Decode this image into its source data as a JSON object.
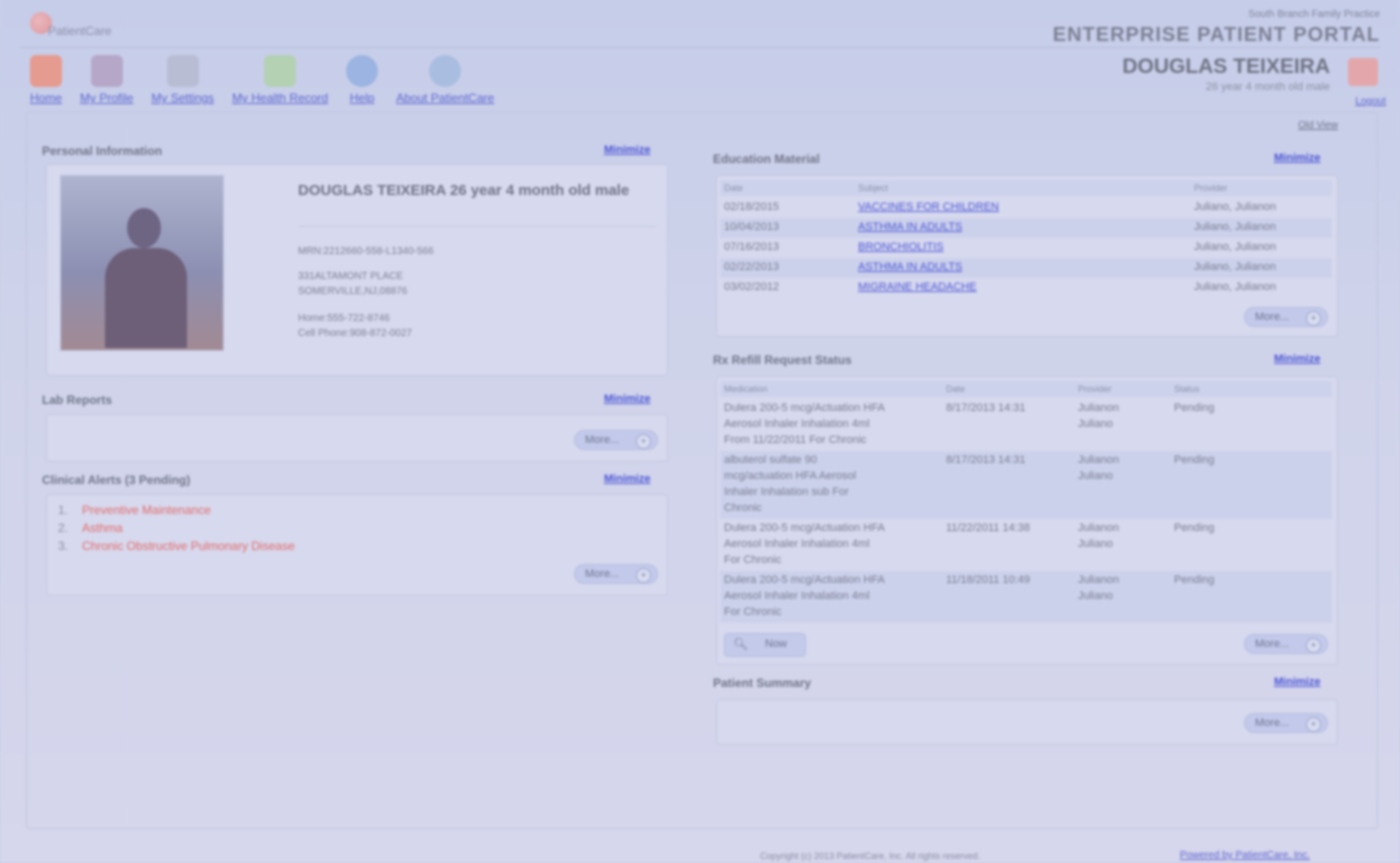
{
  "header": {
    "logo_text": "PatientCare",
    "small_text": "South Branch Family Practice",
    "portal_title": "ENTERPRISE PATIENT PORTAL",
    "patient_name": "DOUGLAS TEIXEIRA",
    "patient_sub": "26 year 4 month old male",
    "logout_label": "Logout",
    "old_view_label": "Old View"
  },
  "nav": [
    {
      "label": "Home",
      "icon": "home-icon",
      "color": "#e59b8f"
    },
    {
      "label": "My Profile",
      "icon": "profile-icon",
      "color": "#b6a7c9"
    },
    {
      "label": "My Settings",
      "icon": "settings-icon",
      "color": "#b9bdd4"
    },
    {
      "label": "My Health Record",
      "icon": "health-record-icon",
      "color": "#b4d1b3"
    },
    {
      "label": "Help",
      "icon": "help-icon",
      "color": "#9bb4e1"
    },
    {
      "label": "About PatientCare",
      "icon": "about-icon",
      "color": "#a9bde0"
    }
  ],
  "personal_info": {
    "title": "Personal Information",
    "minimize": "Minimize",
    "name_line": "DOUGLAS TEIXEIRA 26 year 4 month old male",
    "mrn": "MRN:2212660-558-L1340-566",
    "address1": "331ALTAMONT PLACE",
    "address2": "SOMERVILLE,NJ,08876",
    "home_phone": "Home:555-722-8746",
    "cell_phone": "Cell Phone:908-872-0027"
  },
  "lab_reports": {
    "title": "Lab Reports",
    "minimize": "Minimize",
    "more": "More..."
  },
  "clinical_alerts": {
    "title": "Clinical Alerts (3 Pending)",
    "minimize": "Minimize",
    "more": "More...",
    "items": [
      {
        "num": "1.",
        "text": "Preventive Maintenance"
      },
      {
        "num": "2.",
        "text": "Asthma"
      },
      {
        "num": "3.",
        "text": "Chronic Obstructive Pulmonary Disease"
      }
    ]
  },
  "education": {
    "title": "Education Material",
    "minimize": "Minimize",
    "more": "More...",
    "headers": [
      "Date",
      "Subject",
      "Provider"
    ],
    "rows": [
      {
        "date": "02/18/2015",
        "subject": "VACCINES FOR CHILDREN",
        "provider": "Juliano, Julianon"
      },
      {
        "date": "10/04/2013",
        "subject": "ASTHMA IN ADULTS",
        "provider": "Juliano, Julianon"
      },
      {
        "date": "07/16/2013",
        "subject": "BRONCHIOLITIS",
        "provider": "Juliano, Julianon"
      },
      {
        "date": "02/22/2013",
        "subject": "ASTHMA IN ADULTS",
        "provider": "Juliano, Julianon"
      },
      {
        "date": "03/02/2012",
        "subject": "MIGRAINE HEADACHE",
        "provider": "Juliano, Julianon"
      }
    ]
  },
  "refill": {
    "title": "Rx Refill Request Status",
    "minimize": "Minimize",
    "more": "More...",
    "now": "Now",
    "headers": [
      "Medication",
      "Date",
      "Provider",
      "Status"
    ],
    "rows": [
      {
        "med1": "Dulera 200-5 mcg/Actuation HFA",
        "med2": "Aerosol Inhaler Inhalation 4ml",
        "med3": "From 11/22/2011 For Chronic",
        "med4": "",
        "date": "8/17/2013 14:31",
        "prov1": "Julianon",
        "prov2": "Juliano",
        "status": "Pending"
      },
      {
        "med1": "albuterol sulfate 90",
        "med2": "mcg/actuation HFA Aerosol",
        "med3": "Inhaler Inhalation sub For",
        "med4": "Chronic",
        "date": "8/17/2013 14:31",
        "prov1": "Julianon",
        "prov2": "Juliano",
        "status": "Pending"
      },
      {
        "med1": "Dulera 200-5 mcg/Actuation HFA",
        "med2": "Aerosol Inhaler Inhalation 4ml",
        "med3": "For Chronic",
        "med4": "",
        "date": "11/22/2011 14:38",
        "prov1": "Julianon",
        "prov2": "Juliano",
        "status": "Pending"
      },
      {
        "med1": "Dulera 200-5 mcg/Actuation HFA",
        "med2": "Aerosol Inhaler Inhalation 4ml",
        "med3": "For Chronic",
        "med4": "",
        "date": "11/18/2011 10:49",
        "prov1": "Julianon",
        "prov2": "Juliano",
        "status": "Pending"
      }
    ]
  },
  "patient_summary": {
    "title": "Patient Summary",
    "minimize": "Minimize",
    "more": "More..."
  },
  "footer": {
    "copyright": "Copyright (c) 2013 PatientCare, Inc. All rights reserved.",
    "powered": "Powered by PatientCare, Inc."
  }
}
